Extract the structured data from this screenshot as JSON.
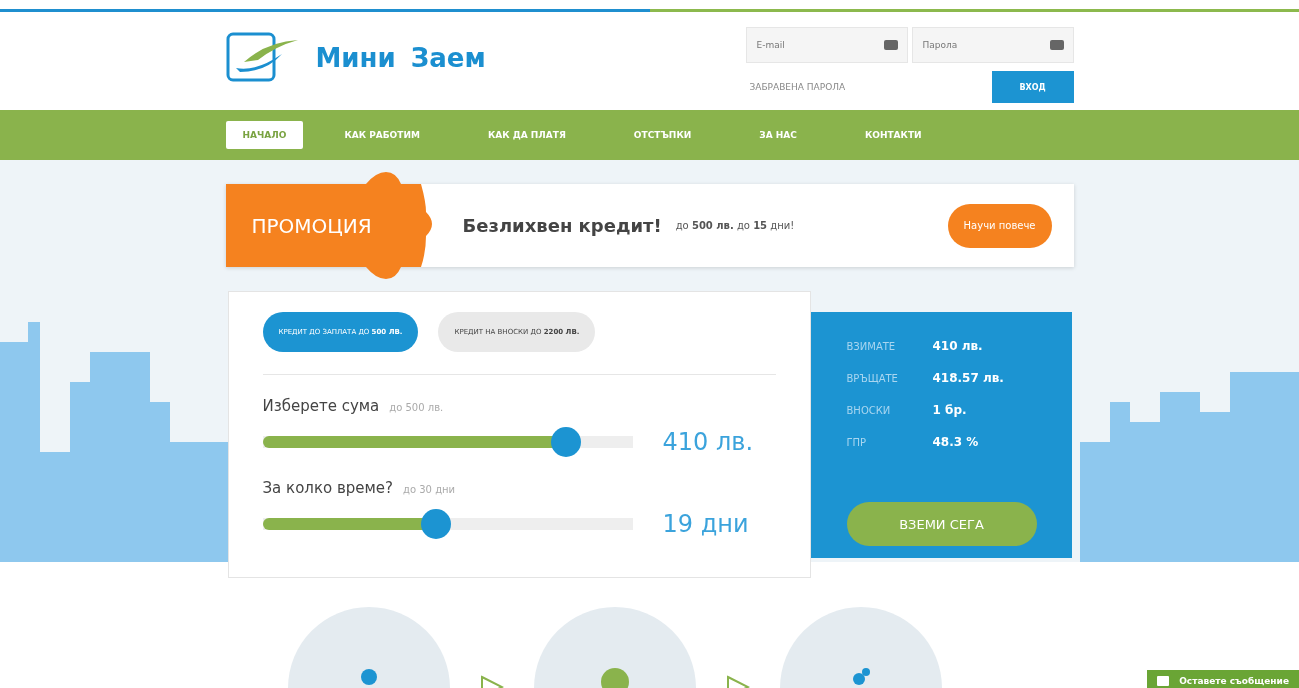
{
  "header": {
    "logo_text": "Мини Заем",
    "email_placeholder": "E-mail",
    "password_placeholder": "Парола",
    "forgot_link": "ЗАБРАВЕНА ПАРОЛА",
    "login_button": "ВХОД"
  },
  "nav": [
    {
      "label": "НАЧАЛО",
      "selected": true
    },
    {
      "label": "КАК РАБОТИМ",
      "selected": false
    },
    {
      "label": "КАК ДА ПЛАТЯ",
      "selected": false
    },
    {
      "label": "ОТСТЪПКИ",
      "selected": false
    },
    {
      "label": "ЗА НАС",
      "selected": false
    },
    {
      "label": "КОНТАКТИ",
      "selected": false
    }
  ],
  "promo": {
    "badge": "ПРОМОЦИЯ",
    "title": "Безлихвен кредит!",
    "details": "до **500 лв.** до **15** дни!",
    "button": "Научи повече"
  },
  "calculator": {
    "loan_types": [
      {
        "label": "КРЕДИТ ДО ЗАПЛАТА ДО **500 ЛВ.**",
        "selected": true
      },
      {
        "label": "КРЕДИТ НА ВНОСКИ ДО **2200 ЛВ.**",
        "selected": false
      }
    ],
    "sliders": [
      {
        "label": "Изберете сума",
        "hint": "до 500 лв.",
        "level": 0.82,
        "value": "410 лв."
      },
      {
        "label": "За колко време?",
        "hint": "до 30 дни",
        "level": 0.47,
        "value": "19 дни"
      }
    ]
  },
  "summary": {
    "rows": [
      {
        "label": "ВЗИМАТЕ",
        "value": "410 лв."
      },
      {
        "label": "ВРЪЩАТЕ",
        "value": "418.57 лв."
      },
      {
        "label": "ВНОСКИ",
        "value": "1 бр."
      },
      {
        "label": "ГПР",
        "value": "48.3 %"
      }
    ],
    "button": "ВЗЕМИ СЕГА"
  },
  "feedback_tab": "Оставете съобщение"
}
